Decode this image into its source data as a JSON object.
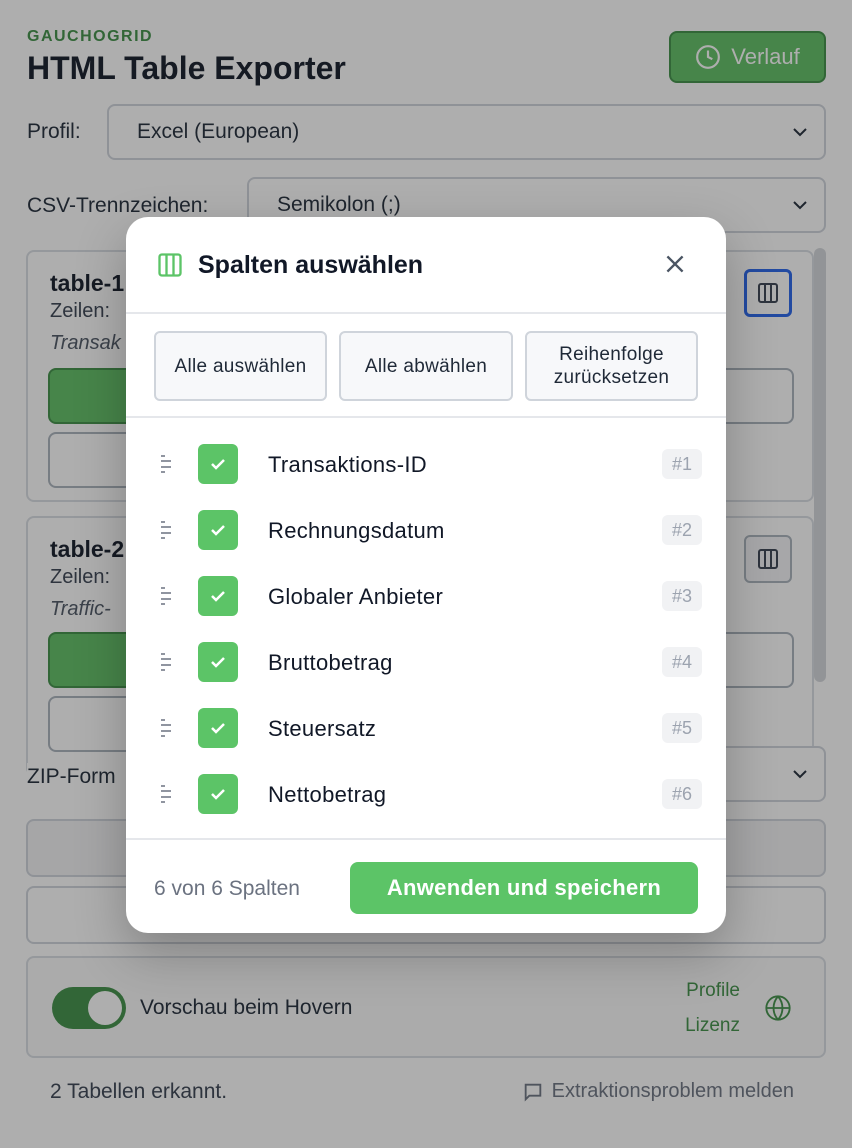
{
  "header": {
    "brand": "GAUCHOGRID",
    "title": "HTML Table Exporter",
    "history_label": "Verlauf"
  },
  "profile": {
    "label": "Profil:",
    "value": "Excel (European)"
  },
  "csv": {
    "label": "CSV-Trennzeichen:",
    "value": "Semikolon (;)"
  },
  "tables": [
    {
      "title": "table-1",
      "rows": "Zeilen:",
      "desc": "Transak"
    },
    {
      "title": "table-2",
      "rows": "Zeilen:",
      "desc": "Traffic-"
    }
  ],
  "zip": {
    "label": "ZIP-Form"
  },
  "preview": {
    "toggle_label": "Vorschau beim Hovern",
    "enabled": true,
    "links": [
      "Profile",
      "Lizenz"
    ]
  },
  "footer": {
    "detected": "2 Tabellen erkannt.",
    "report": "Extraktionsproblem melden"
  },
  "modal": {
    "title": "Spalten auswählen",
    "actions": {
      "select_all": "Alle auswählen",
      "deselect_all": "Alle abwählen",
      "reset_line1": "Reihenfolge",
      "reset_line2": "zurücksetzen"
    },
    "columns": [
      {
        "name": "Transaktions-ID",
        "num": "#1",
        "checked": true
      },
      {
        "name": "Rechnungsdatum",
        "num": "#2",
        "checked": true
      },
      {
        "name": "Globaler Anbieter",
        "num": "#3",
        "checked": true
      },
      {
        "name": "Bruttobetrag",
        "num": "#4",
        "checked": true
      },
      {
        "name": "Steuersatz",
        "num": "#5",
        "checked": true
      },
      {
        "name": "Nettobetrag",
        "num": "#6",
        "checked": true
      }
    ],
    "count": "6 von 6 Spalten",
    "apply": "Anwenden und speichern"
  },
  "icons": {
    "history": "clock-icon",
    "columns": "columns-icon",
    "close": "close-icon",
    "drag": "drag-handle-icon",
    "check": "checkmark-icon",
    "globe": "globe-icon",
    "report": "chat-bubble-icon"
  },
  "colors": {
    "accent": "#5cc467",
    "accent_dark": "#3d8f46",
    "focus": "#2563eb"
  }
}
